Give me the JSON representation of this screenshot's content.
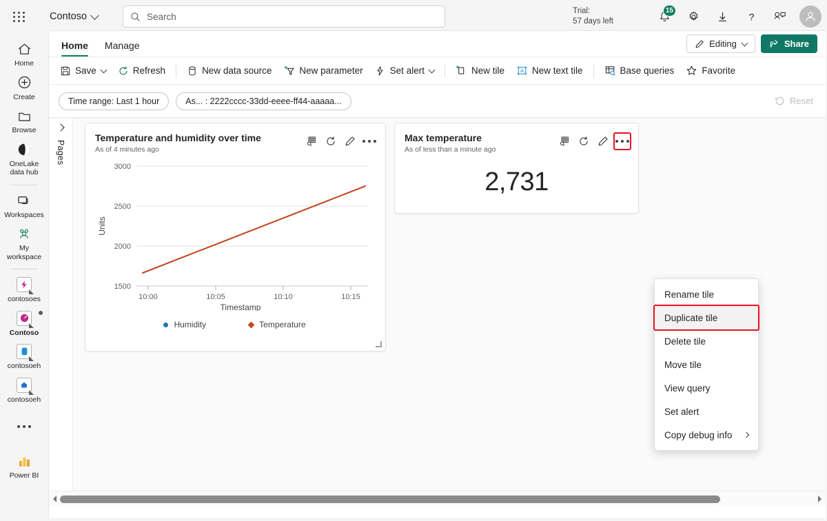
{
  "topbar": {
    "waffle_icon": "app-launcher-icon",
    "brand": "Contoso",
    "search_placeholder": "Search",
    "trial_line1": "Trial:",
    "trial_line2": "57 days left",
    "notification_count": "15",
    "icons": [
      "notification-bell-icon",
      "settings-gear-icon",
      "download-icon",
      "help-question-icon",
      "feedback-icon",
      "account-avatar"
    ]
  },
  "rail": {
    "items": [
      {
        "label": "Home",
        "icon": "home-icon"
      },
      {
        "label": "Create",
        "icon": "plus-circle-icon"
      },
      {
        "label": "Browse",
        "icon": "folder-icon"
      },
      {
        "label": "OneLake\ndata hub",
        "icon": "onelake-icon"
      },
      {
        "label": "Workspaces",
        "icon": "workspaces-icon"
      },
      {
        "label": "My\nworkspace",
        "icon": "my-workspace-icon"
      },
      {
        "label": "contosoes",
        "icon": "eventstream-icon"
      },
      {
        "label": "Contoso",
        "icon": "realtime-dashboard-icon"
      },
      {
        "label": "contosoeh",
        "icon": "database-icon"
      },
      {
        "label": "contosoeh",
        "icon": "eventhouse-icon"
      }
    ],
    "more_label": "more-options-icon",
    "footer_label": "Power BI",
    "footer_icon": "power-bi-icon"
  },
  "ribbon": {
    "tabs": [
      {
        "label": "Home",
        "active": true
      },
      {
        "label": "Manage",
        "active": false
      }
    ],
    "editing_label": "Editing",
    "editing_icon": "pencil-icon",
    "share_label": "Share",
    "share_icon": "share-icon",
    "accent_color": "#107865"
  },
  "commands": [
    {
      "label": "Save",
      "icon": "save-icon",
      "caret": true
    },
    {
      "label": "Refresh",
      "icon": "refresh-icon",
      "caret": false
    },
    {
      "label": "New data source",
      "icon": "database-icon",
      "caret": false
    },
    {
      "label": "New parameter",
      "icon": "new-parameter-icon",
      "caret": false
    },
    {
      "label": "Set alert",
      "icon": "alert-bolt-icon",
      "caret": true
    },
    {
      "label": "New tile",
      "icon": "new-tile-icon",
      "caret": false
    },
    {
      "label": "New text tile",
      "icon": "new-text-tile-icon",
      "caret": false
    },
    {
      "label": "Base queries",
      "icon": "base-queries-icon",
      "caret": false
    },
    {
      "label": "Favorite",
      "icon": "star-icon",
      "caret": false
    }
  ],
  "filterbar": {
    "pills": [
      "Time range: Last 1 hour",
      "As... : 2222cccc-33dd-eeee-ff44-aaaaa..."
    ],
    "reset_label": "Reset",
    "reset_icon": "reset-arrow-icon"
  },
  "canvas": {
    "pages_label": "Pages",
    "pages_chevron_icon": "chevron-right-icon"
  },
  "tiles": [
    {
      "title": "Temperature and humidity over time",
      "subtitle": "As of 4 minutes ago",
      "actions": [
        "explore-data-icon",
        "refresh-icon",
        "edit-pencil-icon",
        "more-options-icon"
      ]
    },
    {
      "title": "Max temperature",
      "subtitle": "As of less than a minute ago",
      "value": "2,731",
      "actions": [
        "explore-data-icon",
        "refresh-icon",
        "edit-pencil-icon",
        "more-options-icon"
      ]
    }
  ],
  "context_menu": {
    "items": [
      {
        "label": "Rename tile",
        "highlighted": false,
        "submenu": false
      },
      {
        "label": "Duplicate tile",
        "highlighted": true,
        "submenu": false
      },
      {
        "label": "Delete tile",
        "highlighted": false,
        "submenu": false
      },
      {
        "label": "Move tile",
        "highlighted": false,
        "submenu": false
      },
      {
        "label": "View query",
        "highlighted": false,
        "submenu": false
      },
      {
        "label": "Set alert",
        "highlighted": false,
        "submenu": false
      },
      {
        "label": "Copy debug info",
        "highlighted": false,
        "submenu": true
      }
    ],
    "highlight_color": "#e81123"
  },
  "chart_data": {
    "type": "line",
    "title": "Temperature and humidity over time",
    "xlabel": "Timestamp",
    "ylabel": "Units",
    "xticks": [
      "10:00",
      "10:05",
      "10:10",
      "10:15"
    ],
    "yticks": [
      1500,
      2000,
      2500,
      3000
    ],
    "ylim": [
      1500,
      3000
    ],
    "grid": true,
    "legend_position": "bottom",
    "series": [
      {
        "name": "Humidity",
        "color": "#1f77b4",
        "marker": "circle",
        "x": [],
        "values": []
      },
      {
        "name": "Temperature",
        "color": "#c04a20",
        "marker": "diamond",
        "x": [
          "09:59",
          "10:05",
          "10:10",
          "10:17"
        ],
        "values": [
          1660,
          2010,
          2310,
          2731
        ]
      }
    ]
  },
  "scrollbar": {
    "left_arrow_icon": "scroll-left-arrow-icon",
    "right_arrow_icon": "scroll-right-arrow-icon",
    "thumb_fraction": "0.875"
  }
}
